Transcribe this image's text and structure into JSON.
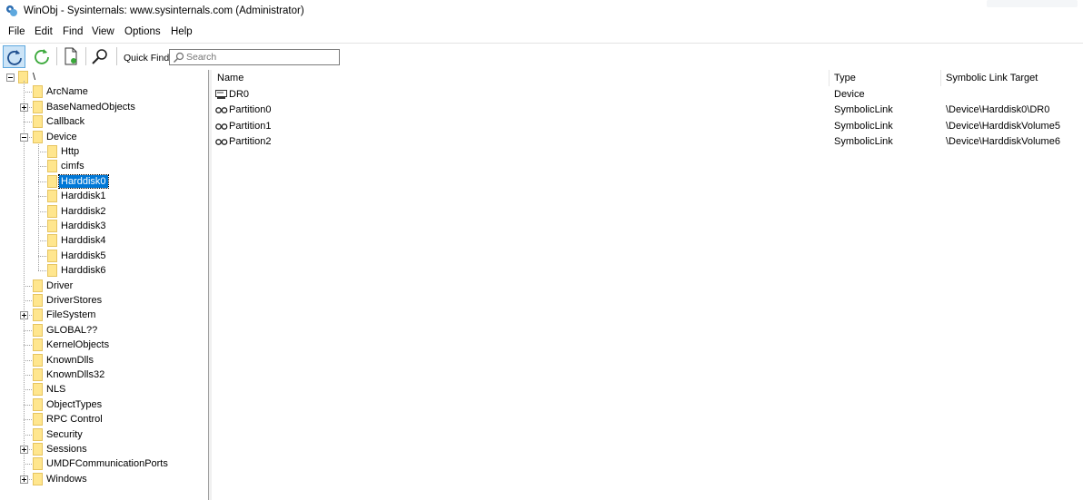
{
  "window": {
    "title": "WinObj - Sysinternals: www.sysinternals.com (Administrator)"
  },
  "menu": [
    "File",
    "Edit",
    "Find",
    "View",
    "Options",
    "Help"
  ],
  "toolbar": {
    "buttons": [
      "refresh-icon",
      "auto-refresh-icon",
      "properties-icon",
      "find-icon"
    ],
    "quick_find_label": "Quick Find:",
    "quick_find_placeholder": "Search"
  },
  "tree": {
    "root": "\\",
    "nodes": [
      {
        "label": "ArcName",
        "depth": 1,
        "expander": "none"
      },
      {
        "label": "BaseNamedObjects",
        "depth": 1,
        "expander": "plus"
      },
      {
        "label": "Callback",
        "depth": 1,
        "expander": "none"
      },
      {
        "label": "Device",
        "depth": 1,
        "expander": "minus"
      },
      {
        "label": "Http",
        "depth": 2,
        "expander": "none"
      },
      {
        "label": "cimfs",
        "depth": 2,
        "expander": "none"
      },
      {
        "label": "Harddisk0",
        "depth": 2,
        "expander": "none",
        "selected": true
      },
      {
        "label": "Harddisk1",
        "depth": 2,
        "expander": "none"
      },
      {
        "label": "Harddisk2",
        "depth": 2,
        "expander": "none"
      },
      {
        "label": "Harddisk3",
        "depth": 2,
        "expander": "none"
      },
      {
        "label": "Harddisk4",
        "depth": 2,
        "expander": "none"
      },
      {
        "label": "Harddisk5",
        "depth": 2,
        "expander": "none"
      },
      {
        "label": "Harddisk6",
        "depth": 2,
        "expander": "none"
      },
      {
        "label": "Driver",
        "depth": 1,
        "expander": "none"
      },
      {
        "label": "DriverStores",
        "depth": 1,
        "expander": "none"
      },
      {
        "label": "FileSystem",
        "depth": 1,
        "expander": "plus"
      },
      {
        "label": "GLOBAL??",
        "depth": 1,
        "expander": "none"
      },
      {
        "label": "KernelObjects",
        "depth": 1,
        "expander": "none"
      },
      {
        "label": "KnownDlls",
        "depth": 1,
        "expander": "none"
      },
      {
        "label": "KnownDlls32",
        "depth": 1,
        "expander": "none"
      },
      {
        "label": "NLS",
        "depth": 1,
        "expander": "none"
      },
      {
        "label": "ObjectTypes",
        "depth": 1,
        "expander": "none"
      },
      {
        "label": "RPC Control",
        "depth": 1,
        "expander": "none"
      },
      {
        "label": "Security",
        "depth": 1,
        "expander": "none"
      },
      {
        "label": "Sessions",
        "depth": 1,
        "expander": "plus"
      },
      {
        "label": "UMDFCommunicationPorts",
        "depth": 1,
        "expander": "none"
      },
      {
        "label": "Windows",
        "depth": 1,
        "expander": "plus"
      }
    ]
  },
  "list": {
    "columns": [
      "Name",
      "Type",
      "Symbolic Link Target"
    ],
    "rows": [
      {
        "icon": "device-icon",
        "name": "DR0",
        "type": "Device",
        "target": ""
      },
      {
        "icon": "symlink-icon",
        "name": "Partition0",
        "type": "SymbolicLink",
        "target": "\\Device\\Harddisk0\\DR0"
      },
      {
        "icon": "symlink-icon",
        "name": "Partition1",
        "type": "SymbolicLink",
        "target": "\\Device\\HarddiskVolume5"
      },
      {
        "icon": "symlink-icon",
        "name": "Partition2",
        "type": "SymbolicLink",
        "target": "\\Device\\HarddiskVolume6"
      }
    ]
  },
  "colors": {
    "selection": "#0078d7",
    "folder": "#ffe68e",
    "accent": "#5ea8de"
  }
}
